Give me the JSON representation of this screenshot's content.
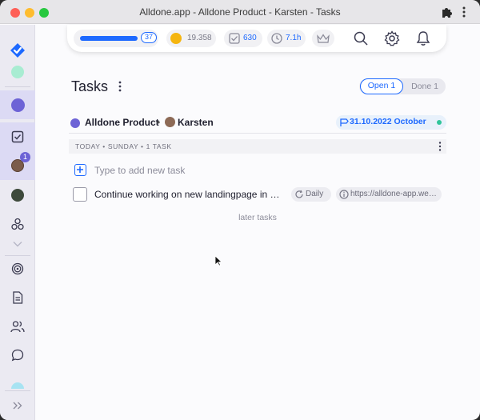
{
  "window": {
    "title": "Alldone.app - Alldone Product - Karsten - Tasks"
  },
  "sidebar": {
    "items": [
      {
        "name": "alldone-logo",
        "icon": "check-diamond-icon"
      },
      {
        "name": "project-green",
        "color": "#a8ecd2"
      },
      {
        "name": "project-purple",
        "color": "#6d63d6",
        "active": true
      },
      {
        "name": "tasks",
        "icon": "checkbox-icon",
        "active": true
      },
      {
        "name": "user-karsten",
        "badge": "1",
        "active": true
      },
      {
        "name": "user-other"
      },
      {
        "name": "goals",
        "icon": "people-graph-icon"
      },
      {
        "name": "more",
        "icon": "chevron-down-icon"
      },
      {
        "name": "target",
        "icon": "target-icon"
      },
      {
        "name": "notes",
        "icon": "document-icon"
      },
      {
        "name": "contacts",
        "icon": "users-icon"
      },
      {
        "name": "chats",
        "icon": "chat-icon"
      },
      {
        "name": "project-cyan",
        "color": "#a7e3f2"
      },
      {
        "name": "expand",
        "icon": "double-chevron-right-icon"
      }
    ]
  },
  "topbar": {
    "progress": {
      "fraction": 0.86,
      "count": "37"
    },
    "gold": "19.358",
    "done": "630",
    "time": "7.1h",
    "accent": "#1d69ff"
  },
  "main": {
    "title": "Tasks",
    "tabs": [
      {
        "label": "Open 1",
        "active": true
      },
      {
        "label": "Done 1",
        "active": false
      }
    ],
    "project": {
      "name": "Alldone Product",
      "separator": "•",
      "person": "Karsten",
      "due": "31.10.2022 October",
      "color": "#6d63d6"
    },
    "day_header": "TODAY • SUNDAY • 1 TASK",
    "add_placeholder": "Type to add new task",
    "tasks": [
      {
        "text": "Continue working on new landingpage in Webflow",
        "recurrence": "Daily",
        "link": "https://alldone-app.webflow.io"
      }
    ],
    "later_label": "later tasks"
  }
}
